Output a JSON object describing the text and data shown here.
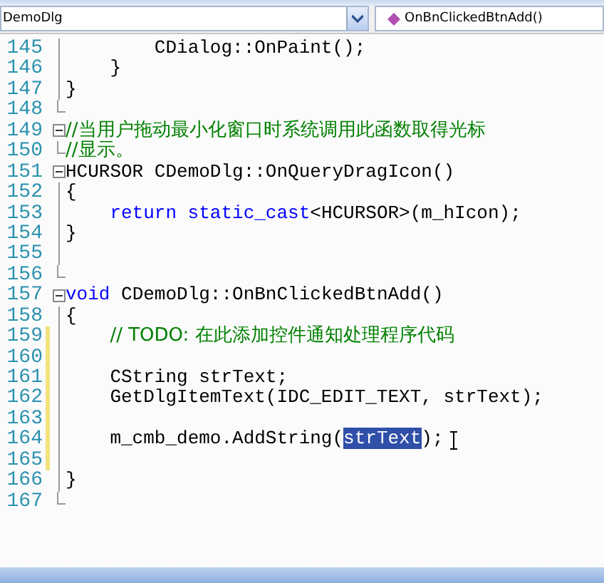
{
  "toolbar": {
    "class_combo": "DemoDlg",
    "member_combo": "OnBnClickedBtnAdd()"
  },
  "lines": [
    {
      "number": "145",
      "kind": "guide",
      "changed": false,
      "segments": [
        {
          "kind": "plain",
          "text": "        CDialog::OnPaint();"
        }
      ]
    },
    {
      "number": "146",
      "kind": "guide",
      "changed": false,
      "segments": [
        {
          "kind": "plain",
          "text": "    }"
        }
      ]
    },
    {
      "number": "147",
      "kind": "guide",
      "changed": false,
      "segments": [
        {
          "kind": "plain",
          "text": "}"
        }
      ]
    },
    {
      "number": "148",
      "kind": "end",
      "changed": false
    },
    {
      "number": "149",
      "kind": "toggle",
      "changed": false,
      "segments": [
        {
          "kind": "comment",
          "text": "//当用户拖动最小化窗口时系统调用此函数取得光标"
        }
      ]
    },
    {
      "number": "150",
      "kind": "end",
      "changed": false,
      "segments": [
        {
          "kind": "comment",
          "text": "//显示。"
        }
      ]
    },
    {
      "number": "151",
      "kind": "toggle",
      "changed": false,
      "segments": [
        {
          "kind": "plain",
          "text": "HCURSOR CDemoDlg::OnQueryDragIcon()"
        }
      ]
    },
    {
      "number": "152",
      "kind": "guide",
      "changed": false,
      "segments": [
        {
          "kind": "plain",
          "text": "{"
        }
      ]
    },
    {
      "number": "153",
      "kind": "guide",
      "changed": false,
      "indented": true,
      "segments": [
        {
          "kind": "keyword",
          "text": "return static_cast"
        },
        {
          "kind": "plain",
          "text": "<HCURSOR>(m_hIcon);"
        }
      ]
    },
    {
      "number": "154",
      "kind": "guide",
      "changed": false,
      "segments": [
        {
          "kind": "plain",
          "text": "}"
        }
      ]
    },
    {
      "number": "155",
      "kind": "guide",
      "changed": false
    },
    {
      "number": "156",
      "kind": "end",
      "changed": false
    },
    {
      "number": "157",
      "kind": "toggle",
      "changed": false,
      "segments": [
        {
          "kind": "keyword",
          "text": "void"
        },
        {
          "kind": "plain",
          "text": " CDemoDlg::OnBnClickedBtnAdd()"
        }
      ]
    },
    {
      "number": "158",
      "kind": "guide",
      "changed": false,
      "segments": [
        {
          "kind": "plain",
          "text": "{"
        }
      ]
    },
    {
      "number": "159",
      "kind": "guide",
      "changed": true,
      "indented": true,
      "segments": [
        {
          "kind": "comment",
          "text": "// TODO: 在此添加控件通知处理程序代码"
        }
      ]
    },
    {
      "number": "160",
      "kind": "guide",
      "changed": true
    },
    {
      "number": "161",
      "kind": "guide",
      "changed": true,
      "segments": [
        {
          "kind": "plain",
          "text": "    CString strText;"
        }
      ]
    },
    {
      "number": "162",
      "kind": "guide",
      "changed": true,
      "segments": [
        {
          "kind": "plain",
          "text": "    GetDlgItemText(IDC_EDIT_TEXT, strText);"
        }
      ]
    },
    {
      "number": "163",
      "kind": "guide",
      "changed": true
    },
    {
      "number": "164",
      "kind": "guide",
      "changed": true,
      "segments": [
        {
          "kind": "plain",
          "text": "    m_cmb_demo.AddString("
        },
        {
          "kind": "selected",
          "text": "strText"
        },
        {
          "kind": "plain",
          "text": ");"
        }
      ]
    },
    {
      "number": "165",
      "kind": "guide",
      "changed": true
    },
    {
      "number": "166",
      "kind": "guide",
      "changed": false,
      "segments": [
        {
          "kind": "plain",
          "text": "}"
        }
      ]
    },
    {
      "number": "167",
      "kind": "end",
      "changed": false
    }
  ]
}
